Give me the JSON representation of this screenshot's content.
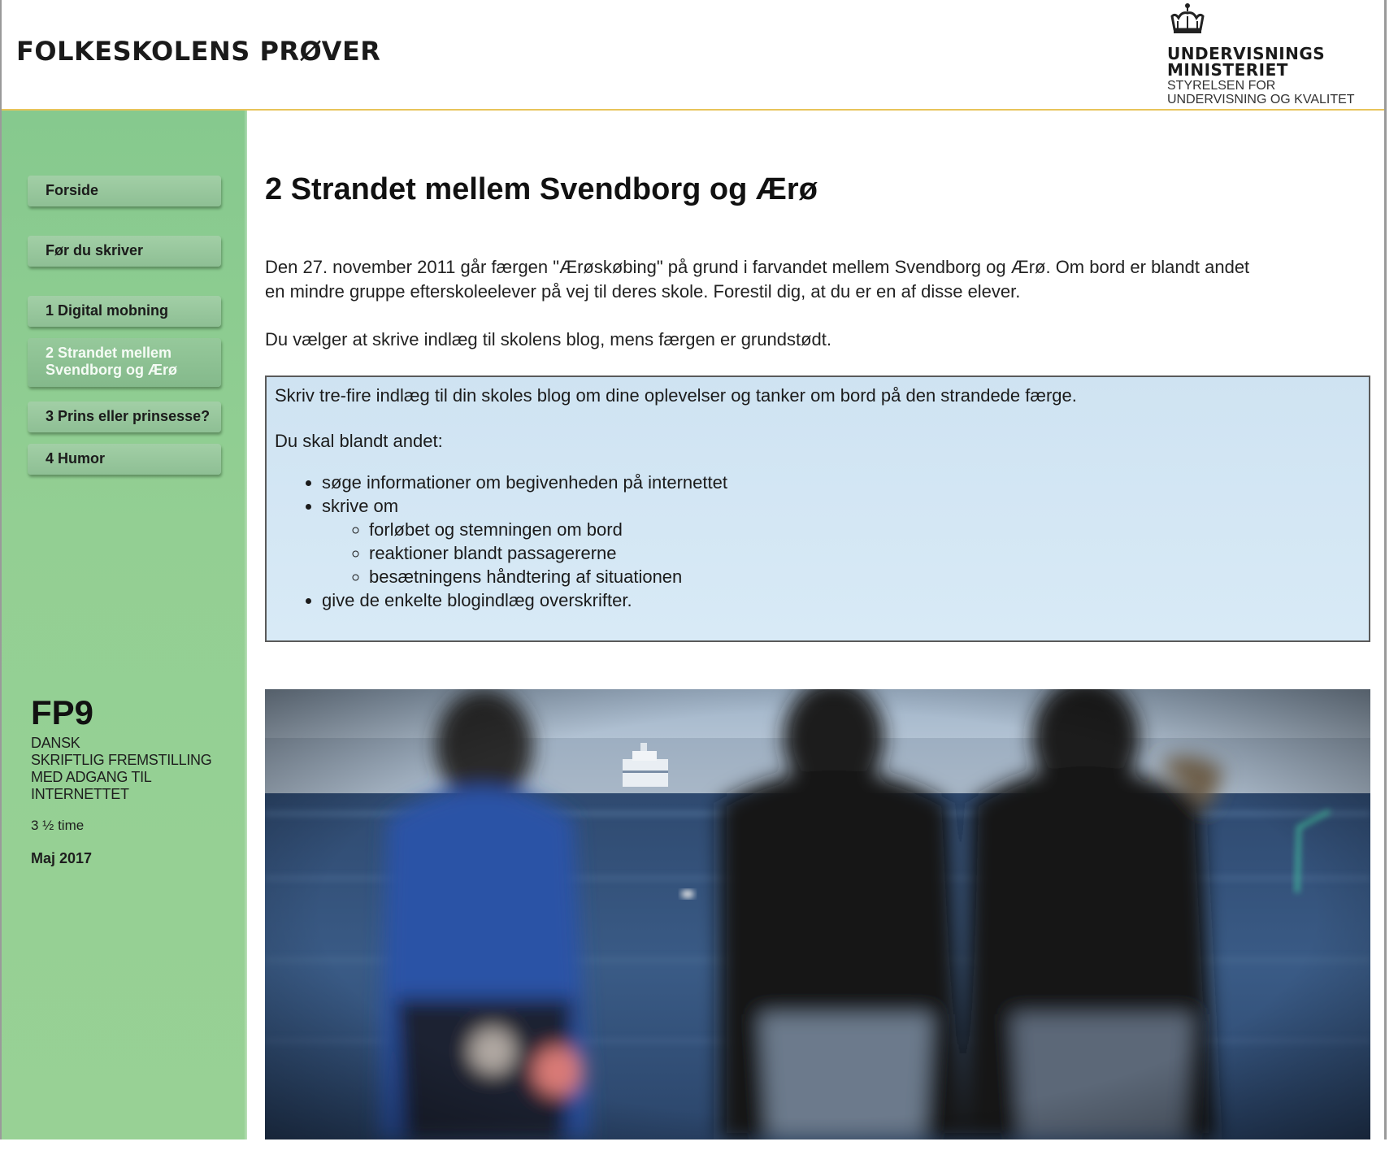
{
  "header": {
    "site_title": "FOLKESKOLENS PRØVER",
    "ministry": {
      "line1": "UNDERVISNINGS",
      "line2": "MINISTERIET",
      "line3": "STYRELSEN FOR",
      "line4": "UNDERVISNING OG KVALITET"
    }
  },
  "sidebar": {
    "nav": [
      {
        "label": "Forside"
      },
      {
        "label": "Før du skriver"
      },
      {
        "label": "1 Digital mobning"
      },
      {
        "label": "2 Strandet mellem Svendborg og Ærø",
        "active": true
      },
      {
        "label": "3 Prins eller prinsesse?"
      },
      {
        "label": "4 Humor"
      }
    ],
    "exam": {
      "code": "FP9",
      "desc_line1": "DANSK",
      "desc_line2": "SKRIFTLIG FREMSTILLING",
      "desc_line3": "MED ADGANG TIL",
      "desc_line4": "INTERNETTET",
      "duration": "3 ½ time",
      "date": "Maj 2017"
    }
  },
  "main": {
    "title": "2 Strandet mellem Svendborg og Ærø",
    "intro_p1_line1": "Den 27. november 2011 går færgen \"Ærøskøbing\" på grund i farvandet mellem Svendborg og Ærø. Om bord er blandt andet",
    "intro_p1_line2": "en mindre gruppe efterskoleelever på vej til deres skole. Forestil dig, at du er en af disse elever.",
    "intro_p2": "Du vælger at skrive indlæg til skolens blog, mens færgen er grundstødt.",
    "task": {
      "instruction": "Skriv tre-fire indlæg til din skoles blog om dine oplevelser og tanker om bord på den strandede færge.",
      "sub_heading": "Du skal blandt andet:",
      "items": [
        "søge informationer om begivenheden på internettet",
        "skrive om",
        "give de enkelte blogindlæg overskrifter."
      ],
      "sub_items": [
        "forløbet og stemningen om bord",
        "reaktioner blandt passagererne",
        "besætningens håndtering af situationen"
      ]
    }
  },
  "colors": {
    "sidebar_green": "#93cf93",
    "nav_button": "#9bc9a0",
    "task_box_bg": "#d3e6f4",
    "header_rule": "#e8c45a"
  },
  "icons": {
    "crown": "crown-icon"
  }
}
